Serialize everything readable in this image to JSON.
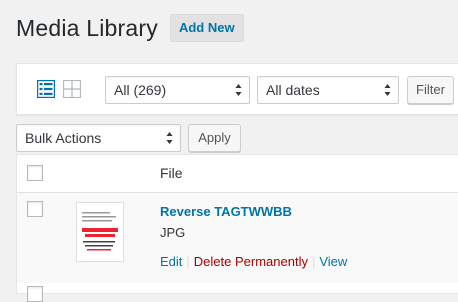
{
  "header": {
    "title": "Media Library",
    "add_new_label": "Add New"
  },
  "filters": {
    "view_modes": [
      "list-icon",
      "grid-icon"
    ],
    "active_view": "list",
    "type_select": "All (269)",
    "date_select": "All dates",
    "filter_button": "Filter"
  },
  "bulk": {
    "select": "Bulk Actions",
    "apply_button": "Apply"
  },
  "table": {
    "column_file": "File",
    "rows": [
      {
        "title": "Reverse TAGTWWBB",
        "type": "JPG",
        "actions": {
          "edit": "Edit",
          "delete": "Delete Permanently",
          "view": "View"
        }
      }
    ]
  },
  "colors": {
    "accent": "#0073aa",
    "danger": "#aa0000",
    "background": "#f1f1f1"
  }
}
